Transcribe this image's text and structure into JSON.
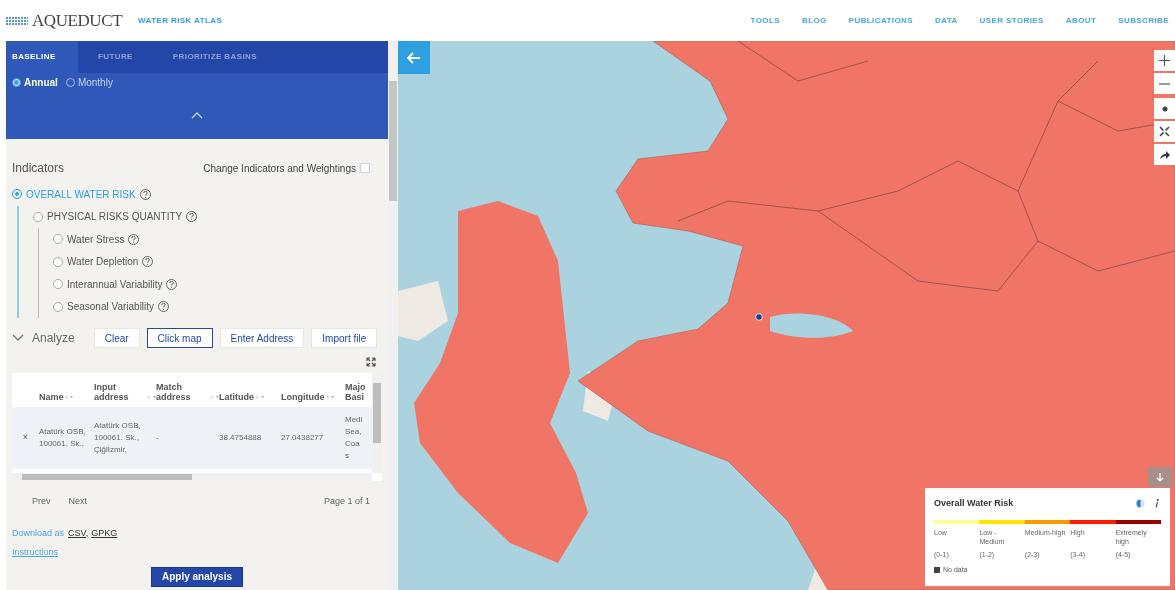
{
  "header": {
    "logo": "AQUEDUCT",
    "subtitle": "WATER RISK ATLAS",
    "nav": [
      "TOOLS",
      "BLOG",
      "PUBLICATIONS",
      "DATA",
      "USER STORIES",
      "ABOUT",
      "SUBSCRIBE"
    ]
  },
  "panel": {
    "tabs": [
      {
        "label": "BASELINE",
        "selected": true
      },
      {
        "label": "FUTURE",
        "selected": false
      },
      {
        "label": "PRIORITIZE BASINS",
        "selected": false
      }
    ],
    "period": [
      {
        "label": "Annual",
        "selected": true
      },
      {
        "label": "Monthly",
        "selected": false
      }
    ],
    "indicators": {
      "title": "Indicators",
      "change_label": "Change Indicators and Weightings",
      "change_checked": false,
      "tree": [
        {
          "label": "OVERALL WATER RISK",
          "selected": true,
          "children": [
            {
              "label": "PHYSICAL RISKS QUANTITY",
              "selected": false,
              "children": [
                {
                  "label": "Water Stress",
                  "selected": false
                },
                {
                  "label": "Water Depletion",
                  "selected": false
                },
                {
                  "label": "Interannual Variability",
                  "selected": false
                },
                {
                  "label": "Seasonal Variability",
                  "selected": false
                }
              ]
            }
          ]
        }
      ]
    },
    "analyze": {
      "title": "Analyze",
      "expanded": true,
      "buttons": [
        {
          "label": "Clear",
          "selected": false
        },
        {
          "label": "Click map",
          "selected": true
        },
        {
          "label": "Enter Address",
          "selected": false
        },
        {
          "label": "Import file",
          "selected": false
        }
      ],
      "table": {
        "columns": [
          {
            "label": "Name",
            "sort": "⌕ ▾"
          },
          {
            "label": "Input address",
            "sort": "⌕ ▾"
          },
          {
            "label": "Match address",
            "sort": "⌕ ▾"
          },
          {
            "label": "Latitude",
            "sort": "⌕ ▾"
          },
          {
            "label": "Longitude",
            "sort": "⌕ ▾"
          },
          {
            "label": "Majo Basi"
          }
        ],
        "rows": [
          {
            "remove": "×",
            "cells": [
              "Atatürk OSB, 100061. Sk.,",
              "Atatürk OSB, 100061. Sk., Çiğlİzmir,",
              "-",
              "38.4754888",
              "27.0438277",
              "Medi Sea, Coas"
            ]
          }
        ]
      },
      "pagination": {
        "prev": "Prev",
        "next": "Next",
        "page": "Page 1 of 1"
      },
      "download_label": "Download as",
      "formats": [
        "CSV,",
        "GPKG"
      ],
      "instructions": "Instructions",
      "apply": "Apply analysis"
    }
  },
  "legend": {
    "title": "Overall Water Risk",
    "levels": [
      {
        "label": "Low",
        "range": "(0-1)",
        "color": "#ffff99"
      },
      {
        "label": "Low - Medium",
        "range": "(1-2)",
        "color": "#ffe600"
      },
      {
        "label": "Medium-high",
        "range": "(2-3)",
        "color": "#ff9900"
      },
      {
        "label": "High",
        "range": "(3-4)",
        "color": "#ff1900"
      },
      {
        "label": "Extremely high",
        "range": "(4-5)",
        "color": "#990000"
      }
    ],
    "no_data": "No data"
  }
}
